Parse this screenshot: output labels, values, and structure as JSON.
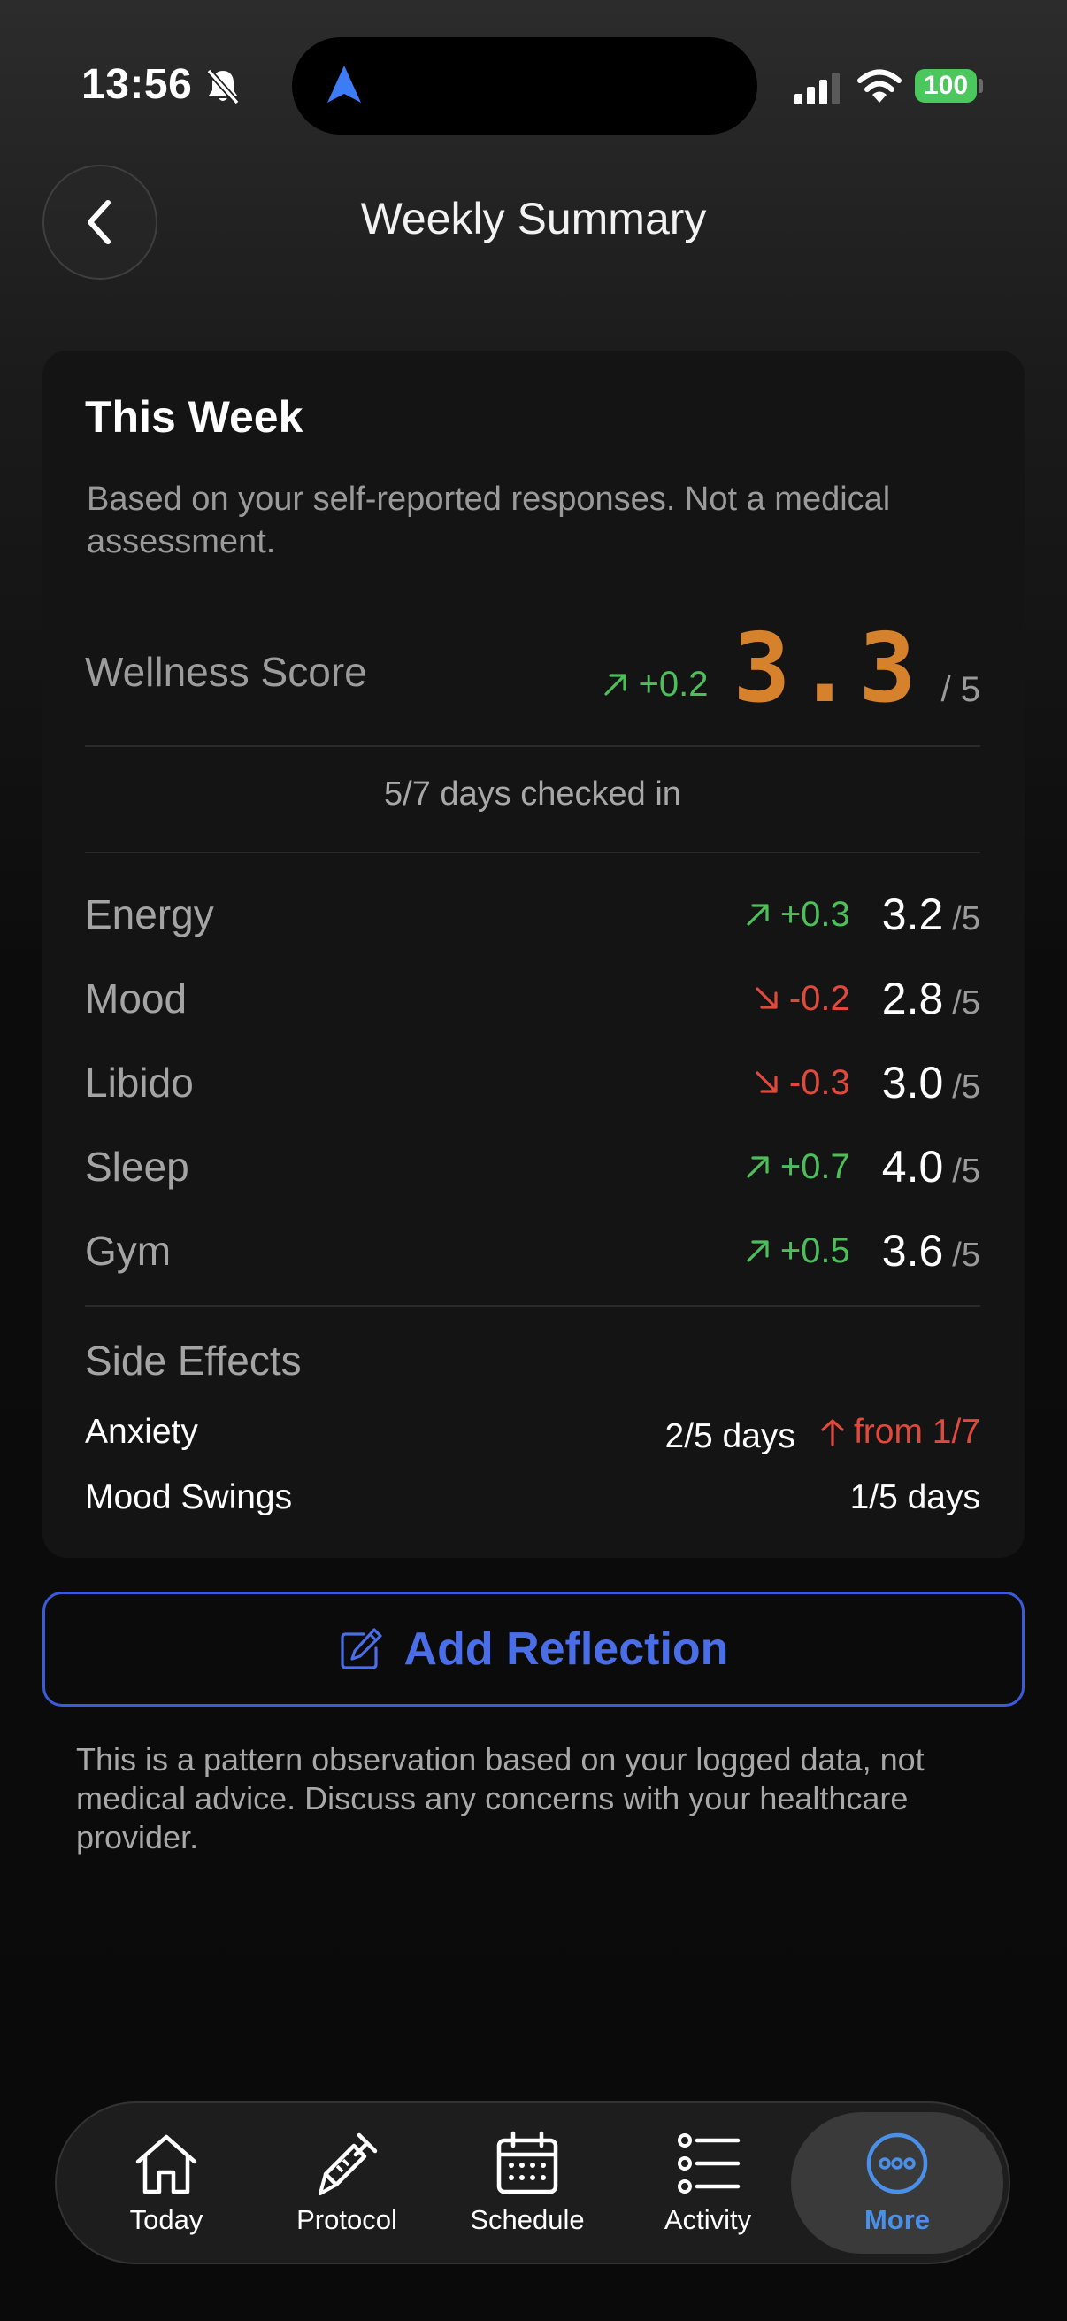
{
  "status_bar": {
    "time": "13:56",
    "battery": "100"
  },
  "header": {
    "title": "Weekly Summary"
  },
  "card": {
    "title": "This Week",
    "subtitle": "Based on your self-reported responses. Not a medical assessment.",
    "wellness": {
      "label": "Wellness Score",
      "delta": "+0.2",
      "value": "3.3",
      "max": "/ 5"
    },
    "checkins": "5/7 days checked in",
    "metrics": [
      {
        "label": "Energy",
        "delta": "+0.3",
        "trend": "up",
        "value": "3.2",
        "max": "/5"
      },
      {
        "label": "Mood",
        "delta": "-0.2",
        "trend": "down",
        "value": "2.8",
        "max": "/5"
      },
      {
        "label": "Libido",
        "delta": "-0.3",
        "trend": "down",
        "value": "3.0",
        "max": "/5"
      },
      {
        "label": "Sleep",
        "delta": "+0.7",
        "trend": "up",
        "value": "4.0",
        "max": "/5"
      },
      {
        "label": "Gym",
        "delta": "+0.5",
        "trend": "up",
        "value": "3.6",
        "max": "/5"
      }
    ],
    "side_effects": {
      "title": "Side Effects",
      "items": [
        {
          "name": "Anxiety",
          "days": "2/5 days",
          "change": "from 1/7"
        },
        {
          "name": "Mood Swings",
          "days": "1/5 days",
          "change": ""
        }
      ]
    }
  },
  "reflection": {
    "label": "Add Reflection"
  },
  "disclaimer": "This is a pattern observation based on your logged data, not medical advice. Discuss any concerns with your healthcare provider.",
  "tabbar": {
    "items": [
      {
        "label": "Today",
        "icon": "home-icon"
      },
      {
        "label": "Protocol",
        "icon": "syringe-icon"
      },
      {
        "label": "Schedule",
        "icon": "calendar-icon"
      },
      {
        "label": "Activity",
        "icon": "list-icon"
      },
      {
        "label": "More",
        "icon": "more-icon"
      }
    ],
    "active": "More",
    "colors": {
      "active": "#4a90e8",
      "accent_score": "#d6822c",
      "trend_up": "#4cbf5b",
      "trend_down": "#e0493c",
      "button": "#4a6ee8"
    }
  }
}
